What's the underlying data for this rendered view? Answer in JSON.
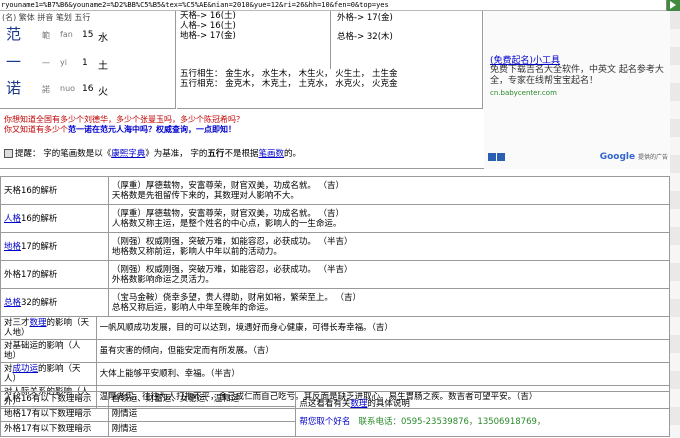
{
  "address_bar": {
    "url": "ryouname1=%B7%B6&youname2=%D2%BB%C5%B5&tex=%C5%AE&nian=2010&yue=12&ri=26&hh=10&fen=0&top=yes"
  },
  "names": {
    "header": "(名)  繁体  拼音  笔划  五行",
    "rows": [
      {
        "char": "范",
        "trad": "範",
        "pinyin": "fan",
        "strokes": "15",
        "element": "水"
      },
      {
        "char": "一",
        "trad": "一",
        "pinyin": "yi",
        "strokes": "1",
        "element": "土"
      },
      {
        "char": "诺",
        "trad": "諾",
        "pinyin": "nuo",
        "strokes": "16",
        "element": "火"
      }
    ]
  },
  "ge": {
    "tian": "天格-> 16(土)",
    "ren": "人格-> 16(土)",
    "di": "地格-> 17(金)",
    "wai": "外格-> 17(金)",
    "zong": "总格-> 32(木)"
  },
  "wuxing": {
    "line1": "五行相生：  金生水，  水生木，  木生火，  火生土，  土生金",
    "line2": "五行相克：  金克木，  木克土，  土克水，  水克火，  火克金"
  },
  "promo": {
    "line1": "你想知道全国有多少个刘德华，多少个张曼玉吗，多少个陈冠希吗？",
    "line2_pre": "你又知道有多少个",
    "line2_name": "范一诺在范元人海中吗？",
    "line2_post": "权威查询，一点即知！"
  },
  "tip": {
    "prefix": "提醒：  字的笔画数是以《",
    "dict": "康熙字典",
    "middle": "》为基准，  字的",
    "bold": "五行",
    "suffix": "不是根据",
    "link": "笔画数",
    "end": "的。"
  },
  "ad": {
    "title": "(免费起名)小工具",
    "text": "免费下载吉名大全软件，中英文 起名参考大全，专家在线帮宝宝起名！",
    "url": "cn.babycenter.com",
    "google": "Google",
    "google_text": "提供的广告"
  },
  "analysis": [
    {
      "label": "天格16的解析",
      "line1": "（厚重）厚德载物，安富尊荣，财官双美，功成名就。        （吉）",
      "line2": "天格数是先祖留传下来的，其数理对人影响不大。"
    },
    {
      "label_link": "人格",
      "label_rest": "16的解析",
      "line1": "（厚重）厚德载物，安富尊荣，财官双美，功成名就。        （吉）",
      "line2": "人格数又称主运，是整个姓名的中心点，影响人的一生命运。"
    },
    {
      "label_link": "地格",
      "label_rest": "17的解析",
      "line1": "（刚强）权威刚强，突破万难，如能容忍，必获成功。        （半吉）",
      "line2": "地格数又称前运，影响人中年以前的活动力。"
    },
    {
      "label": "外格17的解析",
      "line1": "（刚强）权威刚强，突破万难，如能容忍，必获成功。        （半吉）",
      "line2": "外格数影响命运之灵活力。"
    },
    {
      "label_link": "总格",
      "label_rest": "32的解析",
      "line1": "（宝马金鞍）侥幸多望，贵人得助，财帛如裕，繁荣至上。        （吉）",
      "line2": "总格又称后运，影响人中年至晚年的命运。"
    }
  ],
  "influence": [
    {
      "label_pre": "对三才",
      "label_link": "数理",
      "label_post": "的影响（天人地）",
      "desc": "一帆风顺成功发展，目的可以达到，境遇好而身心健康，可得长寿幸福。（吉）"
    },
    {
      "label_pre": "对基础运的影响（人地）",
      "label_link": "",
      "label_post": "",
      "desc": "虽有灾害的倾向，但能安定而有所发展。（吉）"
    },
    {
      "label_pre": "对",
      "label_link": "成功运",
      "label_post": "的影响（天人）",
      "desc": "大体上能够平安顺利、幸福。（半吉）"
    },
    {
      "label_pre": "对人际关系的影响（人外）",
      "label_link": "",
      "label_post": "",
      "desc": "温厚老实，往往为人打抱不平，舍己成仁而自己吃亏。其反面是缺乏进取心。易生胃肠之疾。数吉者可望平安。（吉）"
    }
  ],
  "numtable": {
    "rows": [
      {
        "label": "人格16有以下数理暗示",
        "value": "首领运、财富运、女德运、温和运"
      },
      {
        "label": "地格17有以下数理暗示",
        "value": "刚情运"
      },
      {
        "label": "外格17有以下数理暗示",
        "value": "刚情运"
      }
    ],
    "right_pre": "点这看看有关",
    "right_link": "数理",
    "right_post": "的具体说明",
    "email_label": "帮您取个好名",
    "contact_label": "联系电话：",
    "phone": "0595-23539876，13506918769，"
  }
}
